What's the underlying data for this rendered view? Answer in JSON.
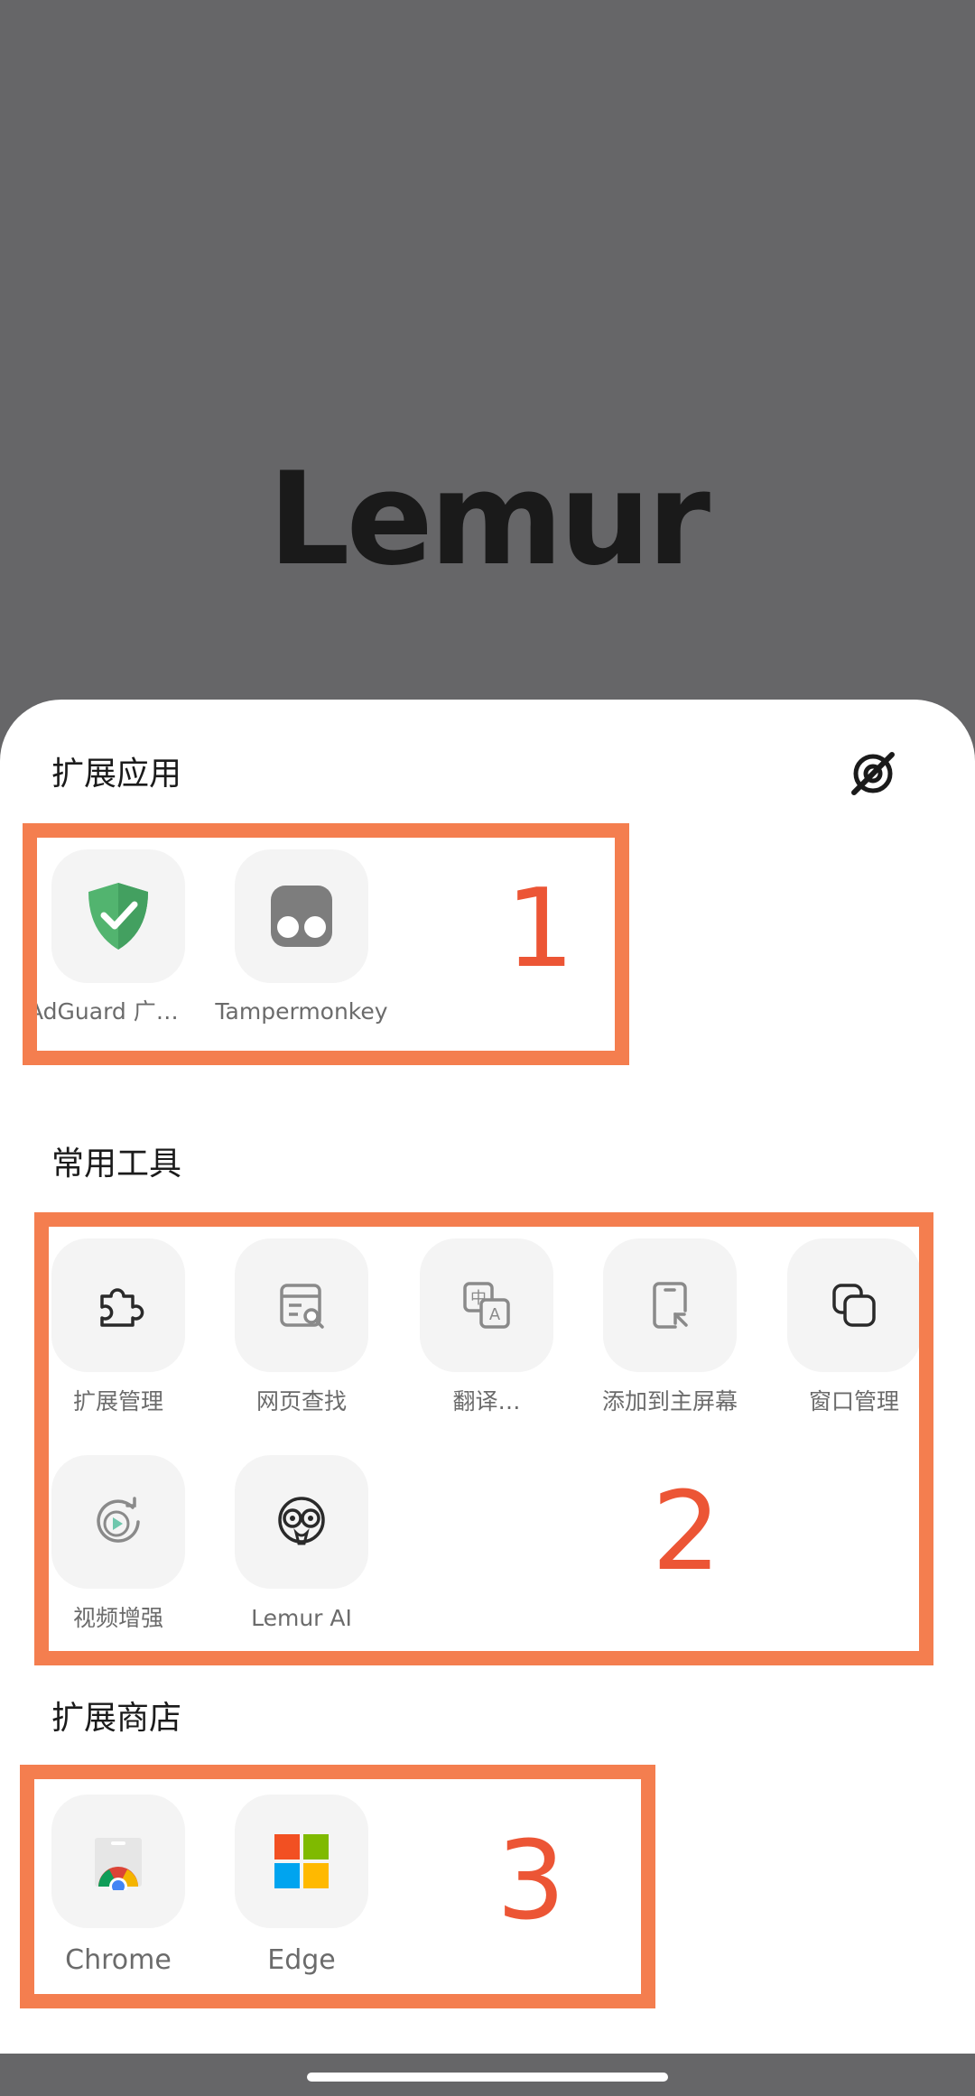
{
  "app": {
    "logo_text": "Lemur"
  },
  "sections": {
    "extensions": {
      "title": "扩展应用",
      "toggle_icon": "eye-slash-icon",
      "items": [
        {
          "label": "AdGuard 广…",
          "icon": "adguard-shield-icon",
          "accent": "#4caf73"
        },
        {
          "label": "Tampermonkey",
          "icon": "tampermonkey-icon",
          "accent": "#808080"
        }
      ]
    },
    "tools": {
      "title": "常用工具",
      "items": [
        {
          "label": "扩展管理",
          "icon": "puzzle-icon"
        },
        {
          "label": "网页查找",
          "icon": "page-search-icon"
        },
        {
          "label": "翻译…",
          "icon": "translate-icon"
        },
        {
          "label": "添加到主屏幕",
          "icon": "add-to-homescreen-icon"
        },
        {
          "label": "窗口管理",
          "icon": "window-manage-icon"
        },
        {
          "label": "视频增强",
          "icon": "video-enhance-icon"
        },
        {
          "label": "Lemur AI",
          "icon": "lemur-ai-icon"
        }
      ]
    },
    "stores": {
      "title": "扩展商店",
      "items": [
        {
          "label": "Chrome",
          "icon": "chrome-store-icon"
        },
        {
          "label": "Edge",
          "icon": "edge-store-icon"
        }
      ]
    }
  },
  "annotations": [
    "1",
    "2",
    "3"
  ],
  "colors": {
    "annotation": "#f47e4f",
    "annotation_text": "#ec5535",
    "backdrop": "#666668"
  }
}
